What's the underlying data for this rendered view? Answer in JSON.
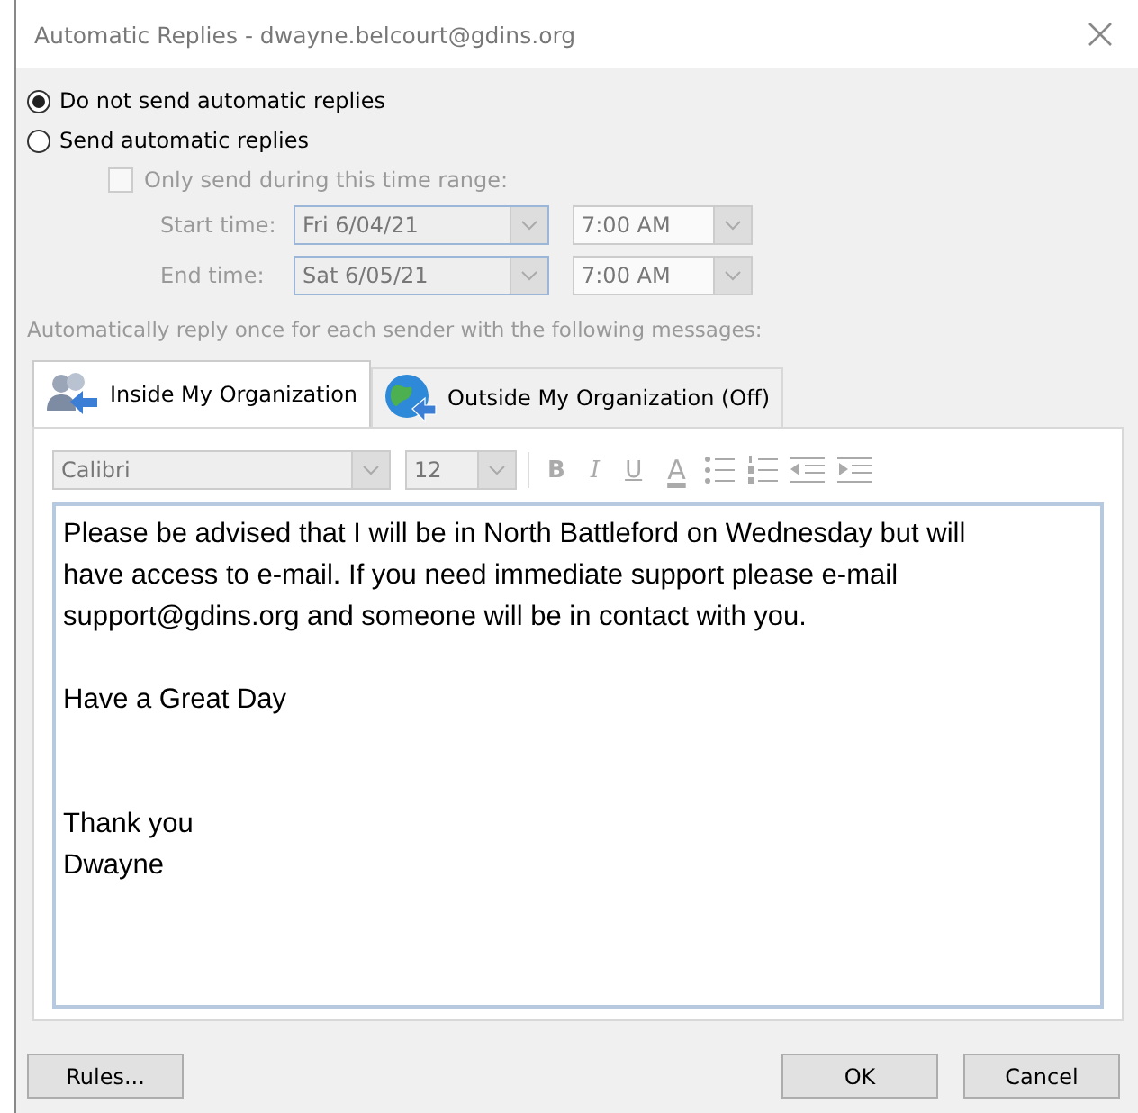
{
  "window": {
    "title": "Automatic Replies - dwayne.belcourt@gdins.org"
  },
  "reply_mode": [
    {
      "label": "Do not send automatic replies",
      "selected": true
    },
    {
      "label": "Send automatic replies",
      "selected": false
    }
  ],
  "time_range": {
    "label": "Only send during this time range:",
    "checked": false,
    "disabled": true,
    "rows": [
      {
        "label": "Start time:",
        "date": "Fri 6/04/21",
        "time": "7:00 AM"
      },
      {
        "label": "End time:",
        "date": "Sat 6/05/21",
        "time": "7:00 AM"
      }
    ]
  },
  "caption": "Automatically reply once for each sender with the following messages:",
  "tabs": [
    {
      "label": "Inside My Organization",
      "selected": true,
      "kind": "people"
    },
    {
      "label": "Outside My Organization (Off)",
      "selected": false,
      "kind": "globe"
    }
  ],
  "toolbar": {
    "font": "Calibri",
    "size": "12",
    "format_buttons": [
      "B",
      "I",
      "U",
      "A"
    ]
  },
  "message": [
    {
      "kind": "body",
      "lines": [
        "Please be advised that I will be in North Battleford on Wednesday but will",
        "have access to e-mail. If you need immediate support please e-mail",
        "support@gdins.org and someone will be in contact with you."
      ]
    },
    {
      "kind": "body",
      "lines": [
        "Have a Great Day"
      ]
    },
    {
      "kind": "signature",
      "lines": [
        "Thank you",
        "Dwayne"
      ]
    }
  ],
  "buttons": {
    "left": "Rules...",
    "ok": "OK",
    "cancel": "Cancel"
  }
}
